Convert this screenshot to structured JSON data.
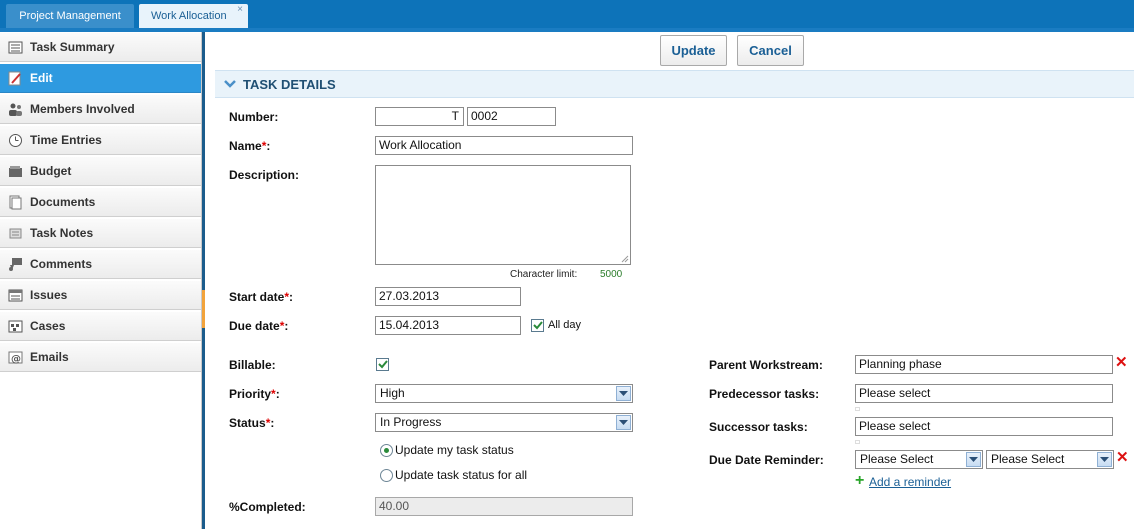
{
  "tabs": [
    {
      "label": "Project Management"
    },
    {
      "label": "Work Allocation",
      "close": "×"
    }
  ],
  "sidebar": {
    "items": [
      {
        "label": "Task Summary"
      },
      {
        "label": "Edit"
      },
      {
        "label": "Members Involved"
      },
      {
        "label": "Time Entries"
      },
      {
        "label": "Budget"
      },
      {
        "label": "Documents"
      },
      {
        "label": "Task Notes"
      },
      {
        "label": "Comments"
      },
      {
        "label": "Issues"
      },
      {
        "label": "Cases"
      },
      {
        "label": "Emails"
      }
    ]
  },
  "toolbar": {
    "update_label": "Update",
    "cancel_label": "Cancel"
  },
  "section": {
    "title": "TASK DETAILS"
  },
  "form": {
    "number_label": "Number:",
    "number_prefix": "T",
    "number_value": "0002",
    "name_label": "Name",
    "name_value": "Work Allocation",
    "description_label": "Description:",
    "char_limit_label": "Character limit:",
    "char_limit_value": "5000",
    "start_label": "Start date",
    "start_value": "27.03.2013",
    "due_label": "Due date",
    "due_value": "15.04.2013",
    "all_day_label": "All day",
    "billable_label": "Billable:",
    "priority_label": "Priority",
    "priority_value": "High",
    "status_label": "Status",
    "status_value": "In Progress",
    "radio_my_label": "Update my task status",
    "radio_all_label": "Update task status for all",
    "completed_label": "%Completed:",
    "completed_value": "40.00",
    "parent_label": "Parent Workstream:",
    "parent_value": "Planning phase",
    "predecessor_label": "Predecessor tasks:",
    "predecessor_value": "Please select",
    "successor_label": "Successor tasks:",
    "successor_value": "Please select",
    "reminder_label": "Due Date Reminder:",
    "reminder_value_1": "Please Select",
    "reminder_value_2": "Please Select",
    "add_reminder_label": "Add a reminder",
    "required_mark": "*",
    "colon": ":"
  },
  "colors": {
    "accent": "#2e9ae0",
    "topbar": "#0d73b9",
    "required": "#d00000",
    "check": "#2a8a3a"
  }
}
